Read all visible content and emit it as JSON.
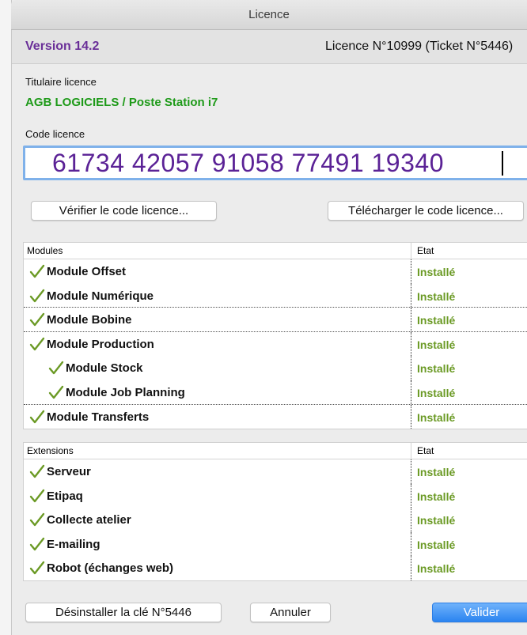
{
  "window": {
    "title": "Licence"
  },
  "header": {
    "version": "Version 14.2",
    "licence_number": "Licence N°10999 (Ticket N°5446)"
  },
  "holder": {
    "label": "Titulaire licence",
    "value": "AGB LOGICIELS / Poste Station i7"
  },
  "code": {
    "label": "Code licence",
    "value": "61734 42057 91058 77491 19340"
  },
  "buttons": {
    "verify": "Vérifier le code licence...",
    "download": "Télécharger le code licence...",
    "uninstall": "Désinstaller la clé N°5446",
    "cancel": "Annuler",
    "validate": "Valider"
  },
  "colors": {
    "accent": "#6a2f98",
    "holder": "#1e9a19",
    "installed": "#6b9a25",
    "focus": "#7fb1ea",
    "primary": "#2b84f0"
  },
  "modules": {
    "col_name": "Modules",
    "col_state": "Etat",
    "rows": [
      {
        "name": "Module Offset",
        "state": "Installé",
        "indent": 0
      },
      {
        "name": "Module Numérique",
        "state": "Installé",
        "indent": 0
      },
      {
        "name": "Module Bobine",
        "state": "Installé",
        "indent": 0
      },
      {
        "name": "Module Production",
        "state": "Installé",
        "indent": 0
      },
      {
        "name": "Module Stock",
        "state": "Installé",
        "indent": 1
      },
      {
        "name": "Module Job Planning",
        "state": "Installé",
        "indent": 1
      },
      {
        "name": "Module Transferts",
        "state": "Installé",
        "indent": 0
      }
    ]
  },
  "extensions": {
    "col_name": "Extensions",
    "col_state": "Etat",
    "rows": [
      {
        "name": "Serveur",
        "state": "Installé",
        "indent": 0
      },
      {
        "name": "Etipaq",
        "state": "Installé",
        "indent": 0
      },
      {
        "name": "Collecte atelier",
        "state": "Installé",
        "indent": 0
      },
      {
        "name": "E-mailing",
        "state": "Installé",
        "indent": 0
      },
      {
        "name": "Robot (échanges web)",
        "state": "Installé",
        "indent": 0
      }
    ]
  }
}
